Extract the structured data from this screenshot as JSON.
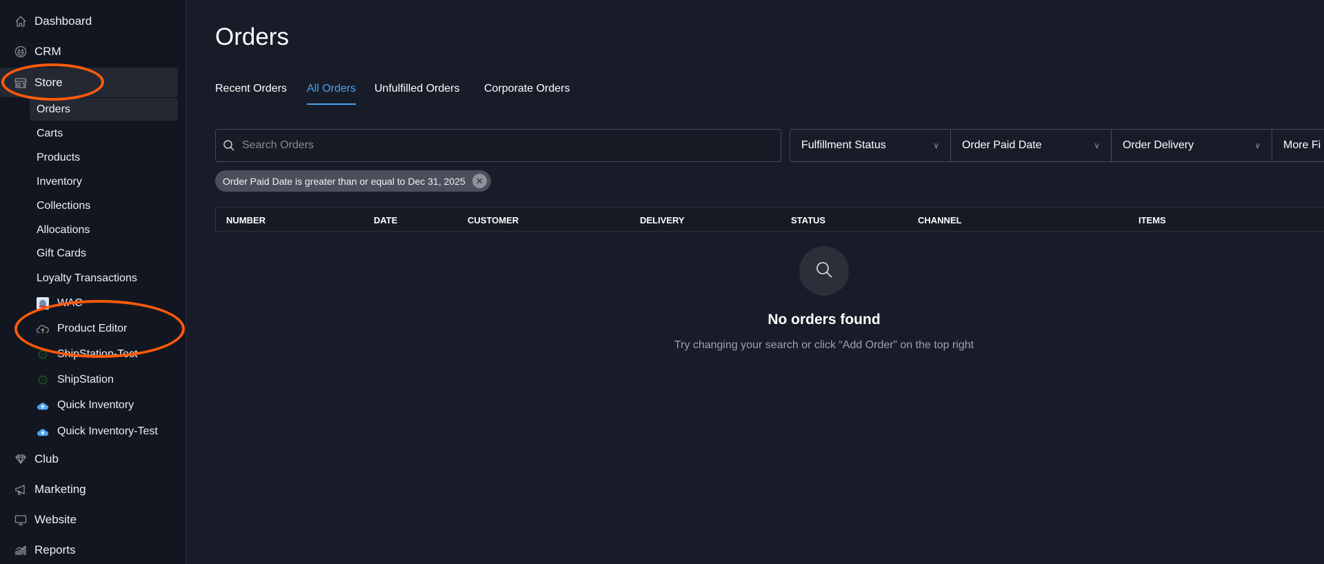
{
  "sidebar": {
    "top": [
      {
        "label": "Dashboard",
        "icon": "home-icon"
      },
      {
        "label": "CRM",
        "icon": "smiley-icon"
      },
      {
        "label": "Store",
        "icon": "storefront-icon"
      }
    ],
    "store_items": [
      "Orders",
      "Carts",
      "Products",
      "Inventory",
      "Collections",
      "Allocations",
      "Gift Cards",
      "Loyalty Transactions"
    ],
    "apps": [
      {
        "label": "WAC",
        "icon": "wac-logo-icon"
      },
      {
        "label": "Product Editor",
        "icon": "cloud-upload-outline-icon"
      },
      {
        "label": "ShipStation-Test",
        "icon": "gear-icon"
      },
      {
        "label": "ShipStation",
        "icon": "gear-icon"
      },
      {
        "label": "Quick Inventory",
        "icon": "cloud-upload-icon"
      },
      {
        "label": "Quick Inventory-Test",
        "icon": "cloud-upload-icon"
      }
    ],
    "bottom": [
      {
        "label": "Club",
        "icon": "diamond-icon"
      },
      {
        "label": "Marketing",
        "icon": "megaphone-icon"
      },
      {
        "label": "Website",
        "icon": "monitor-icon"
      },
      {
        "label": "Reports",
        "icon": "bar-chart-icon"
      }
    ]
  },
  "annotation_color": "#ff5a0a",
  "accent": "#4aa3ee",
  "main": {
    "title": "Orders",
    "tabs": [
      "Recent Orders",
      "All Orders",
      "Unfulfilled Orders",
      "Corporate Orders"
    ],
    "active_tab": "All Orders",
    "search_placeholder": "Search Orders",
    "filters": [
      "Fulfillment Status",
      "Order Paid Date",
      "Order Delivery",
      "More Fi"
    ],
    "chip": "Order Paid Date is greater than or equal to Dec 31, 2025",
    "columns": [
      "NUMBER",
      "DATE",
      "CUSTOMER",
      "DELIVERY",
      "STATUS",
      "CHANNEL",
      "ITEMS"
    ],
    "empty_title": "No orders found",
    "empty_sub": "Try changing your search or click “Add Order” on the top right"
  }
}
